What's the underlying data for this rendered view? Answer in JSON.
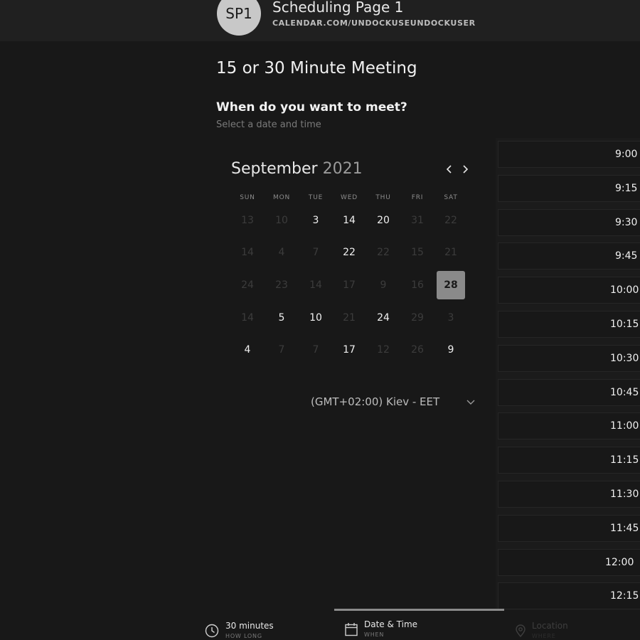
{
  "header": {
    "avatar_initials": "SP1",
    "page_name": "Scheduling Page 1",
    "page_url": "CALENDAR.COM/UNDOCKUSEUNDOCKUSER"
  },
  "meeting": {
    "title": "15 or 30 Minute Meeting",
    "question": "When do you want to meet?",
    "hint": "Select a date and time"
  },
  "calendar": {
    "month": "September",
    "year": "2021",
    "prev_icon": "chevron-left-icon",
    "next_icon": "chevron-right-icon",
    "weekdays": [
      "SUN",
      "MON",
      "TUE",
      "WED",
      "THU",
      "FRI",
      "SAT"
    ],
    "weeks": [
      [
        {
          "t": "13",
          "s": "off"
        },
        {
          "t": "10",
          "s": "off"
        },
        {
          "t": "3",
          "s": "avail"
        },
        {
          "t": "14",
          "s": "avail"
        },
        {
          "t": "20",
          "s": "avail"
        },
        {
          "t": "31",
          "s": "off"
        },
        {
          "t": "22",
          "s": "off"
        }
      ],
      [
        {
          "t": "14",
          "s": "off"
        },
        {
          "t": "4",
          "s": "off"
        },
        {
          "t": "7",
          "s": "off"
        },
        {
          "t": "22",
          "s": "avail"
        },
        {
          "t": "22",
          "s": "off"
        },
        {
          "t": "15",
          "s": "off"
        },
        {
          "t": "21",
          "s": "off"
        }
      ],
      [
        {
          "t": "24",
          "s": "off"
        },
        {
          "t": "23",
          "s": "off"
        },
        {
          "t": "14",
          "s": "off"
        },
        {
          "t": "17",
          "s": "off"
        },
        {
          "t": "9",
          "s": "off"
        },
        {
          "t": "16",
          "s": "off"
        },
        {
          "t": "28",
          "s": "sel"
        }
      ],
      [
        {
          "t": "14",
          "s": "off"
        },
        {
          "t": "5",
          "s": "avail"
        },
        {
          "t": "10",
          "s": "avail"
        },
        {
          "t": "21",
          "s": "off"
        },
        {
          "t": "24",
          "s": "avail"
        },
        {
          "t": "29",
          "s": "off"
        },
        {
          "t": "3",
          "s": "off"
        }
      ],
      [
        {
          "t": "4",
          "s": "avail"
        },
        {
          "t": "7",
          "s": "off"
        },
        {
          "t": "7",
          "s": "off"
        },
        {
          "t": "17",
          "s": "avail"
        },
        {
          "t": "12",
          "s": "off"
        },
        {
          "t": "26",
          "s": "off"
        },
        {
          "t": "9",
          "s": "avail"
        }
      ]
    ]
  },
  "timezone": {
    "label": "(GMT+02:00) Kiev - EET",
    "icon": "chevron-down-icon"
  },
  "time_slots": [
    "9:00 /",
    "9:15 /",
    "9:30 A",
    "9:45 A",
    "10:00 /",
    "10:15 /",
    "10:30 /",
    "10:45 /",
    "11:00 /",
    "11:15 /",
    "11:30 /",
    "11:45 /",
    "12:00",
    "12:15 /"
  ],
  "steps": [
    {
      "label": "30 minutes",
      "sub": "HOW LONG",
      "icon": "clock-icon"
    },
    {
      "label": "Date & Time",
      "sub": "WHEN",
      "icon": "calendar-icon"
    },
    {
      "label": "Location",
      "sub": "WHERE",
      "icon": "location-pin-icon"
    }
  ]
}
